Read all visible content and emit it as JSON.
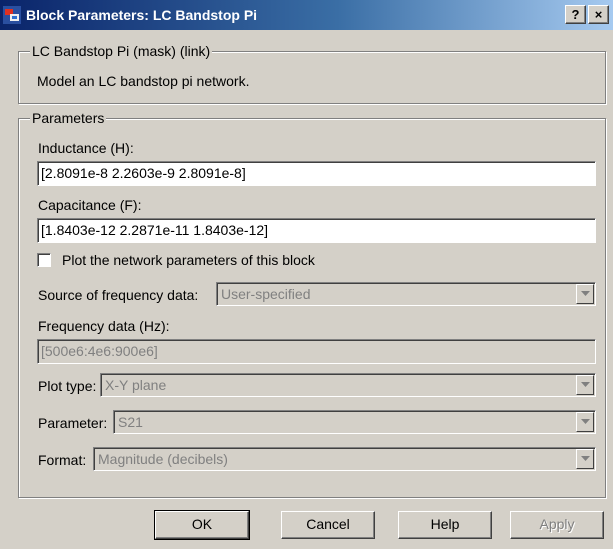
{
  "window": {
    "title": "Block Parameters: LC Bandstop Pi",
    "help_glyph": "?",
    "close_glyph": "×",
    "titlebar_colors": [
      "#0a246a",
      "#a6caf0"
    ]
  },
  "description": {
    "group_title": "LC Bandstop Pi (mask) (link)",
    "text": "Model an LC bandstop pi network."
  },
  "parameters": {
    "group_title": "Parameters",
    "inductance": {
      "label": "Inductance (H):",
      "value": "[2.8091e-8  2.2603e-9  2.8091e-8]"
    },
    "capacitance": {
      "label": "Capacitance (F):",
      "value": "[1.8403e-12  2.2871e-11  1.8403e-12]"
    },
    "plot_checkbox": {
      "label": "Plot the network parameters of this block",
      "checked": false
    },
    "source_freq": {
      "label": "Source of frequency data:",
      "value": "User-specified",
      "enabled": false
    },
    "freq_data": {
      "label": "Frequency data (Hz):",
      "value": "[500e6:4e6:900e6]",
      "enabled": false
    },
    "plot_type": {
      "label": "Plot type:",
      "value": "X-Y plane",
      "enabled": false
    },
    "parameter": {
      "label": "Parameter:",
      "value": "S21",
      "enabled": false
    },
    "format": {
      "label": "Format:",
      "value": "Magnitude (decibels)",
      "enabled": false
    }
  },
  "buttons": {
    "ok": "OK",
    "cancel": "Cancel",
    "help": "Help",
    "apply": "Apply"
  },
  "icons": [
    "simulink-block-icon",
    "help-icon",
    "close-icon",
    "dropdown-arrow-icon"
  ]
}
